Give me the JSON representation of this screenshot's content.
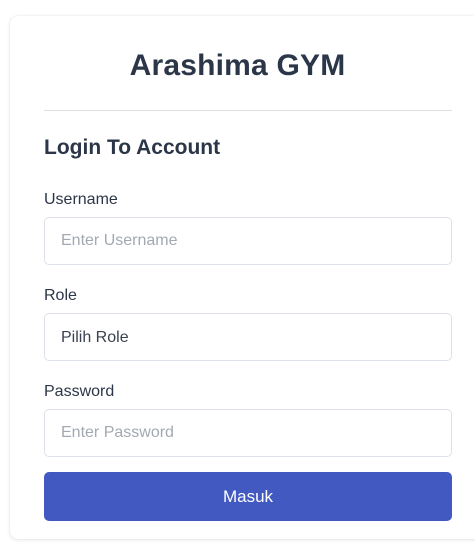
{
  "app": {
    "title": "Arashima GYM"
  },
  "form": {
    "heading": "Login To Account",
    "username": {
      "label": "Username",
      "placeholder": "Enter Username",
      "value": ""
    },
    "role": {
      "label": "Role",
      "selected": "Pilih Role",
      "options": [
        "Pilih Role"
      ]
    },
    "password": {
      "label": "Password",
      "placeholder": "Enter Password",
      "value": ""
    },
    "submit_label": "Masuk"
  },
  "colors": {
    "accent": "#4259c1",
    "text": "#2b3648",
    "border": "#dde2e8",
    "placeholder": "#a3a9b2"
  }
}
